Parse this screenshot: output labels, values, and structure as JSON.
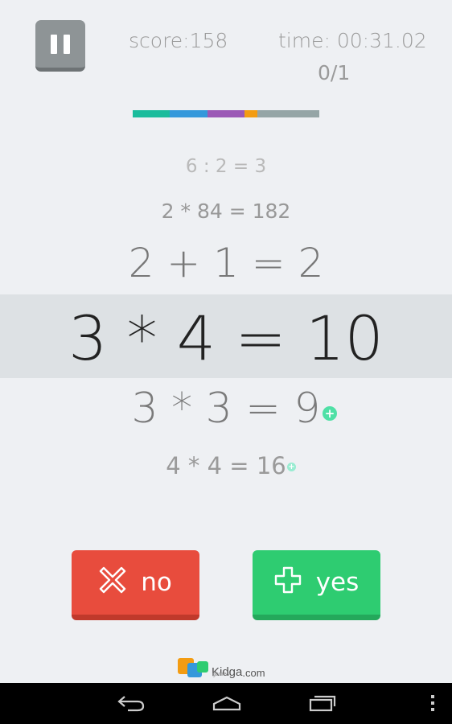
{
  "header": {
    "score": "score:158",
    "time": "time: 00:31.02",
    "progress": "0/1"
  },
  "progress_segments": [
    {
      "color": "#1abc9c",
      "fraction": 0.2
    },
    {
      "color": "#3498db",
      "fraction": 0.2
    },
    {
      "color": "#9b59b6",
      "fraction": 0.2
    },
    {
      "color": "#f39c12",
      "fraction": 0.07
    },
    {
      "color": "#95a5a6",
      "fraction": 0.33
    }
  ],
  "equations": {
    "eq1": "6 : 2 = 3",
    "eq2": "2 * 84 = 182",
    "eq3": "2 + 1 = 2",
    "current": "3 * 4 = 10",
    "eq5": "3 * 3 = 9",
    "eq6": "4 * 4 = 16"
  },
  "buttons": {
    "no_label": "no",
    "yes_label": "yes"
  },
  "brand": {
    "name": "Kidga",
    "suffix": ".com",
    "sub": "games"
  },
  "colors": {
    "no": "#e84c3d",
    "yes": "#2ecc71",
    "plus_badge": "#4fe0a6"
  },
  "icons": {
    "pause": "pause-icon",
    "no": "x-icon",
    "yes": "plus-icon",
    "back": "back-icon",
    "home": "home-icon",
    "recents": "recents-icon",
    "menu": "overflow-menu-icon"
  }
}
